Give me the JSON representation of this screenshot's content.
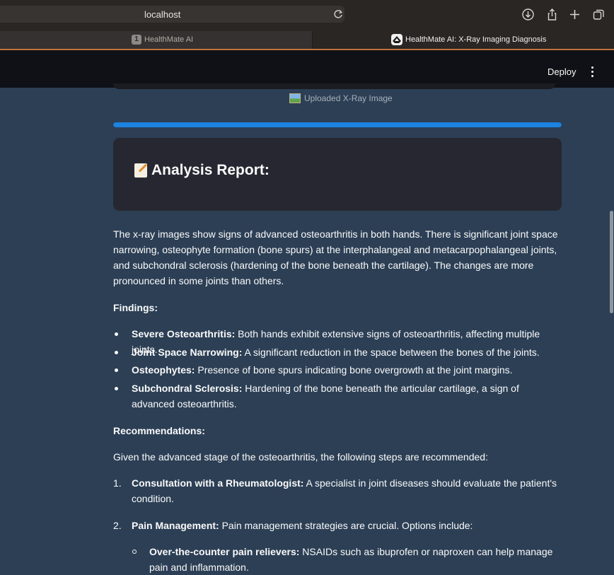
{
  "browser": {
    "url": "localhost",
    "tabs": [
      {
        "badge": "1",
        "title": "HealthMate AI"
      },
      {
        "title": "HealthMate AI: X-Ray Imaging Diagnosis"
      }
    ]
  },
  "header": {
    "deploy_label": "Deploy"
  },
  "image_caption": "Uploaded X-Ray Image",
  "progress": {
    "fraction": 1.0
  },
  "report": {
    "title": "Analysis Report:",
    "intro": "The x-ray images show signs of advanced osteoarthritis in both hands. There is significant joint space narrowing, osteophyte formation (bone spurs) at the interphalangeal and metacarpophalangeal joints, and subchondral sclerosis (hardening of the bone beneath the cartilage). The changes are more pronounced in some joints than others.",
    "findings_heading": "Findings:",
    "findings": [
      {
        "term": "Severe Osteoarthritis:",
        "text": " Both hands exhibit extensive signs of osteoarthritis, affecting multiple joints."
      },
      {
        "term": "Joint Space Narrowing:",
        "text": " A significant reduction in the space between the bones of the joints."
      },
      {
        "term": "Osteophytes:",
        "text": " Presence of bone spurs indicating bone overgrowth at the joint margins."
      },
      {
        "term": "Subchondral Sclerosis:",
        "text": " Hardening of the bone beneath the articular cartilage, a sign of advanced osteoarthritis."
      }
    ],
    "recommendations_heading": "Recommendations:",
    "recommendations_intro": "Given the advanced stage of the osteoarthritis, the following steps are recommended:",
    "recommendations": [
      {
        "number": "1.",
        "term": "Consultation with a Rheumatologist:",
        "text": " A specialist in joint diseases should evaluate the patient's condition."
      },
      {
        "number": "2.",
        "term": "Pain Management:",
        "text": " Pain management strategies are crucial. Options include:"
      }
    ],
    "pain_options": [
      {
        "term": "Over-the-counter pain relievers:",
        "text": " NSAIDs such as ibuprofen or naproxen can help manage pain and inflammation."
      }
    ]
  },
  "colors": {
    "accent": "#1c83e1",
    "background": "#2c3f55",
    "card": "#262730",
    "header": "#0f1116"
  }
}
